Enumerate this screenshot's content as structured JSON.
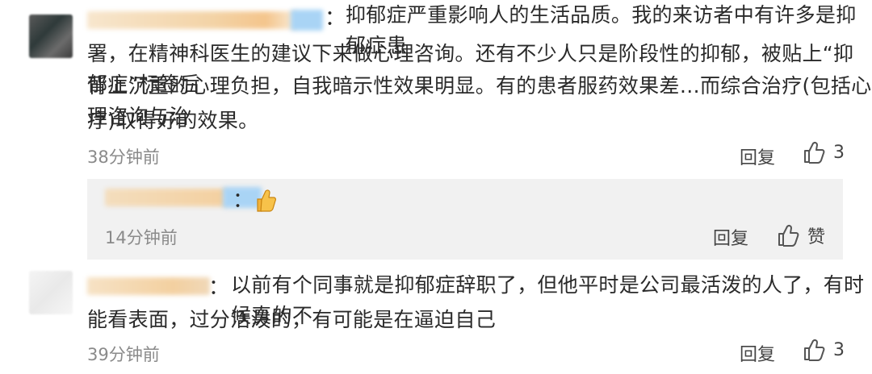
{
  "comments": [
    {
      "text_lines": [
        "抑郁症严重影响人的生活品质。我的来访者中有许多是抑郁症患",
        "署，在精神科医生的建议下来做心理咨询。还有不少人只是阶段性的抑郁，被贴上“抑郁症”标签后",
        "背上沉重的心理负担，自我暗示性效果明显。有的患者服药效果差…而综合治疗(包括心理咨询与治",
        "疗)取得好的效果。"
      ],
      "time": "38分钟前",
      "reply_label": "回复",
      "like_count": "3"
    },
    {
      "time": "14分钟前",
      "reply_label": "回复",
      "like_label": "赞"
    },
    {
      "text_lines": [
        "以前有个同事就是抑郁症辞职了，但他平时是公司最活泼的人了，有时候真的不",
        "能看表面，过分活泼的，有可能是在逼迫自己"
      ],
      "time": "39分钟前",
      "reply_label": "回复",
      "like_count": "3"
    }
  ],
  "colon": "：",
  "colors": {
    "text": "#2a2a2a",
    "meta": "#8a8a8a",
    "reply_bg": "#f1f1f1",
    "name_blur_orange": "#f3d3a6",
    "name_blur_blue": "#a9d4f5"
  },
  "icons": [
    "thumbs-up-outline-icon",
    "thumbs-up-emoji-icon"
  ]
}
